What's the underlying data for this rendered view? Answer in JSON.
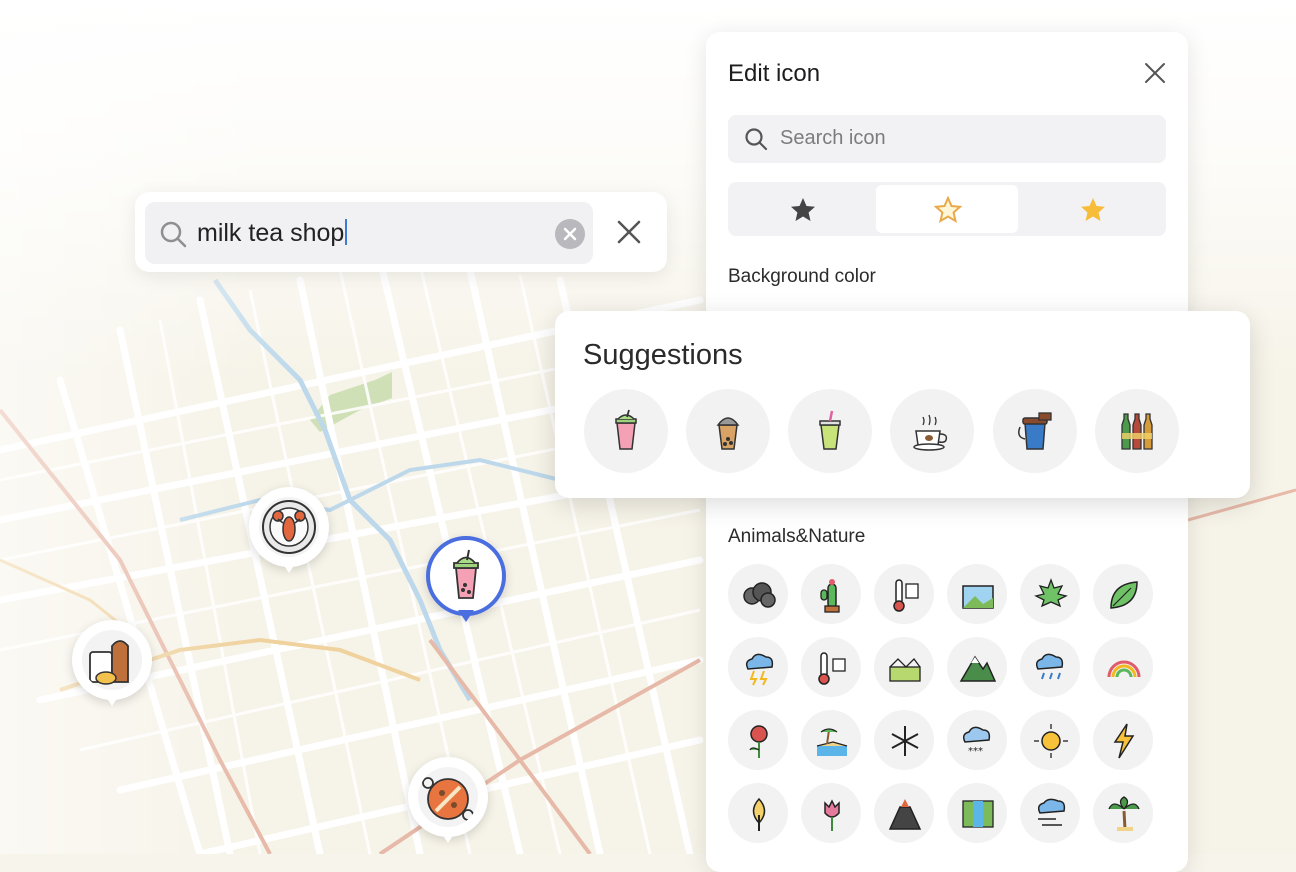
{
  "search": {
    "query": "milk tea shop"
  },
  "panel": {
    "title": "Edit icon",
    "search_placeholder": "Search icon",
    "styles": [
      "filled-star",
      "outline-star",
      "colored-star"
    ],
    "background_color_label": "Background color",
    "category_label": "Animals&Nature",
    "grid_icons": [
      "smoke-cloud-icon",
      "cactus-icon",
      "thermometer-icon",
      "landscape-photo-icon",
      "maple-leaf-icon",
      "leaf-icon",
      "thunderstorm-icon",
      "temperature-icon",
      "field-icon",
      "mountain-icon",
      "rain-cloud-icon",
      "rainbow-icon",
      "rose-icon",
      "beach-icon",
      "snowflake-icon",
      "snow-cloud-icon",
      "sun-icon",
      "lightning-icon",
      "tree-icon",
      "tulip-icon",
      "volcano-icon",
      "waterfall-icon",
      "windy-cloud-icon",
      "palm-tree-icon"
    ]
  },
  "suggestions": {
    "title": "Suggestions",
    "items": [
      "strawberry-milk-tea-icon",
      "bubble-tea-icon",
      "green-tea-drink-icon",
      "coffee-cup-icon",
      "takeaway-coffee-icon",
      "bottled-drinks-icon"
    ]
  },
  "map_pins": [
    "lobster-restaurant-icon",
    "milk-tea-shop-icon",
    "bakery-icon",
    "paella-icon"
  ],
  "colors": {
    "accent": "#4a6ee0",
    "panel_bg": "#ffffff"
  }
}
